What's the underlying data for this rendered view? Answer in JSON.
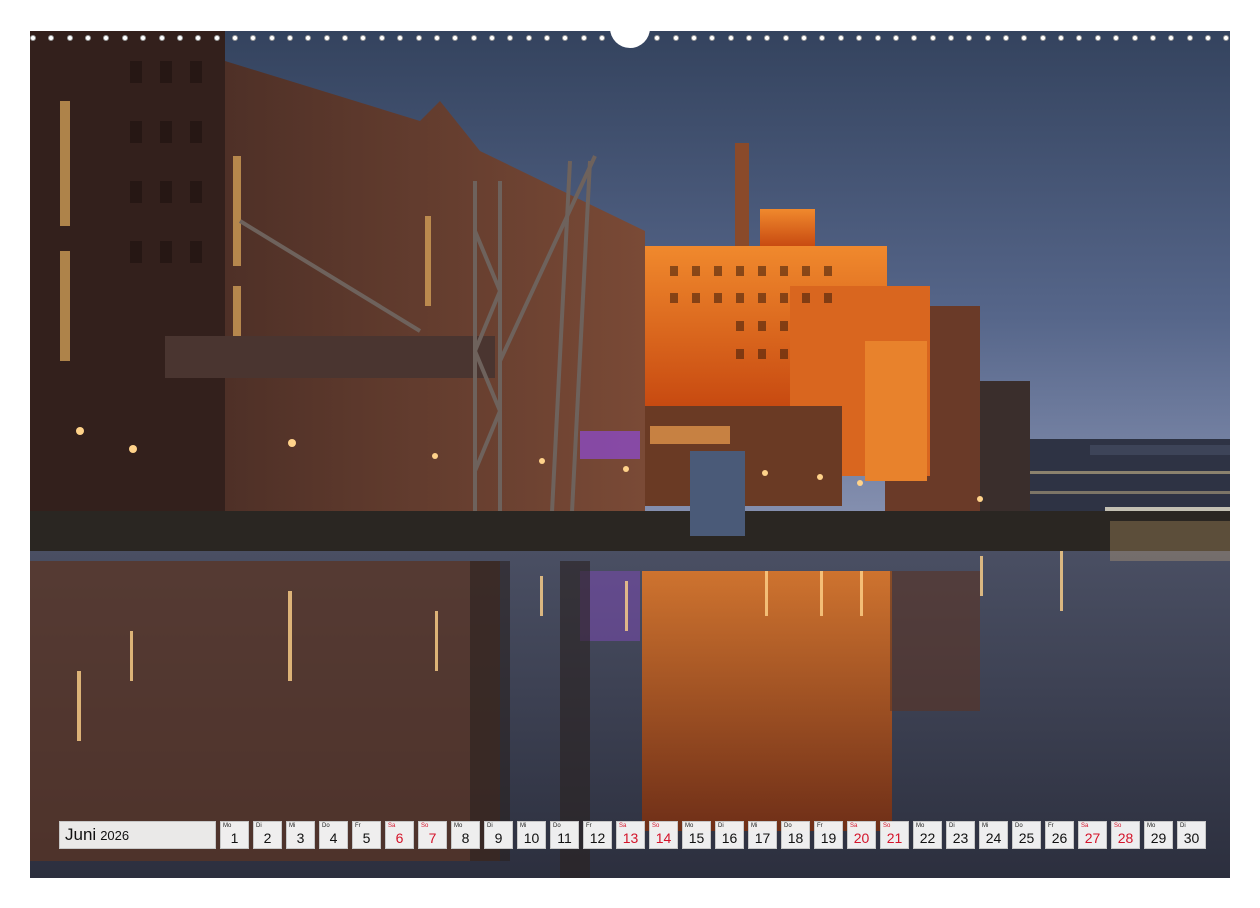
{
  "calendar": {
    "month": "Juni",
    "year": "2026",
    "days": [
      {
        "wd": "Mo",
        "d": "1",
        "we": false
      },
      {
        "wd": "Di",
        "d": "2",
        "we": false
      },
      {
        "wd": "Mi",
        "d": "3",
        "we": false
      },
      {
        "wd": "Do",
        "d": "4",
        "we": false
      },
      {
        "wd": "Fr",
        "d": "5",
        "we": false
      },
      {
        "wd": "Sa",
        "d": "6",
        "we": true
      },
      {
        "wd": "So",
        "d": "7",
        "we": true
      },
      {
        "wd": "Mo",
        "d": "8",
        "we": false
      },
      {
        "wd": "Di",
        "d": "9",
        "we": false
      },
      {
        "wd": "Mi",
        "d": "10",
        "we": false
      },
      {
        "wd": "Do",
        "d": "11",
        "we": false
      },
      {
        "wd": "Fr",
        "d": "12",
        "we": false
      },
      {
        "wd": "Sa",
        "d": "13",
        "we": true
      },
      {
        "wd": "So",
        "d": "14",
        "we": true
      },
      {
        "wd": "Mo",
        "d": "15",
        "we": false
      },
      {
        "wd": "Di",
        "d": "16",
        "we": false
      },
      {
        "wd": "Mi",
        "d": "17",
        "we": false
      },
      {
        "wd": "Do",
        "d": "18",
        "we": false
      },
      {
        "wd": "Fr",
        "d": "19",
        "we": false
      },
      {
        "wd": "Sa",
        "d": "20",
        "we": true
      },
      {
        "wd": "So",
        "d": "21",
        "we": true
      },
      {
        "wd": "Mo",
        "d": "22",
        "we": false
      },
      {
        "wd": "Di",
        "d": "23",
        "we": false
      },
      {
        "wd": "Mi",
        "d": "24",
        "we": false
      },
      {
        "wd": "Do",
        "d": "25",
        "we": false
      },
      {
        "wd": "Fr",
        "d": "26",
        "we": false
      },
      {
        "wd": "Sa",
        "d": "27",
        "we": true
      },
      {
        "wd": "So",
        "d": "28",
        "we": true
      },
      {
        "wd": "Mo",
        "d": "29",
        "we": false
      },
      {
        "wd": "Di",
        "d": "30",
        "we": false
      }
    ]
  },
  "colors": {
    "weekend": "#d4142a",
    "building_glow": "#e86a1c",
    "sky_top": "#3a4a64",
    "sky_bottom": "#8a96b4"
  }
}
